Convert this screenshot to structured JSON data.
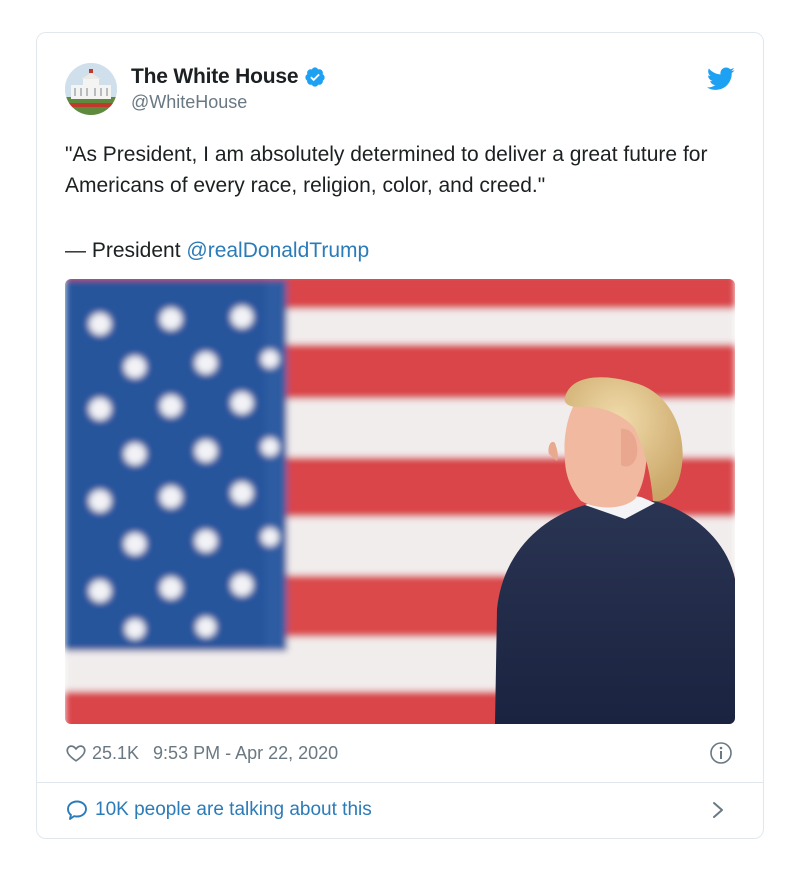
{
  "author": {
    "display_name": "The White House",
    "handle": "@WhiteHouse",
    "verified": true
  },
  "tweet": {
    "text": "\"As President, I am absolutely determined to deliver a great future for Americans of every race, religion, color, and creed.\"",
    "attribution_prefix": "— President ",
    "mention": "@realDonaldTrump"
  },
  "meta": {
    "likes": "25.1K",
    "timestamp": "9:53 PM - Apr 22, 2020"
  },
  "conversation": {
    "label": "10K people are talking about this"
  },
  "icons": {
    "brand": "twitter-bird-icon",
    "verified": "verified-badge-icon",
    "like": "heart-icon",
    "info": "info-icon",
    "conversation": "speech-bubble-icon",
    "chevron": "chevron-right-icon"
  },
  "colors": {
    "link": "#2b7bb9",
    "brand": "#1da1f2",
    "muted": "#697882",
    "border": "#e1e8ed"
  }
}
